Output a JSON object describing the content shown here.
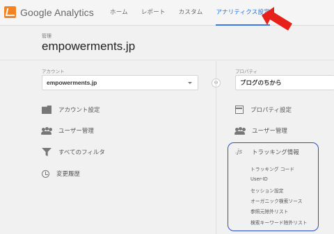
{
  "app": {
    "logo_text": "Google Analytics"
  },
  "nav": {
    "items": [
      {
        "label": "ホーム"
      },
      {
        "label": "レポート"
      },
      {
        "label": "カスタム"
      },
      {
        "label": "アナリティクス設定"
      }
    ],
    "active_index": 3
  },
  "header": {
    "breadcrumb": "管理",
    "site_name": "empowerments.jp"
  },
  "account": {
    "label": "アカウント",
    "selected": "empowerments.jp",
    "menu": [
      {
        "label": "アカウント設定",
        "icon": "building-icon"
      },
      {
        "label": "ユーザー管理",
        "icon": "people-icon"
      },
      {
        "label": "すべてのフィルタ",
        "icon": "filter-icon"
      },
      {
        "label": "変更履歴",
        "icon": "history-icon"
      }
    ]
  },
  "property": {
    "label": "プロパティ",
    "selected": "ブログのちから",
    "menu": [
      {
        "label": "プロパティ設定",
        "icon": "property-icon"
      },
      {
        "label": "ユーザー管理",
        "icon": "people-icon"
      },
      {
        "label": "トラッキング情報",
        "icon": "js-icon"
      }
    ],
    "tracking_sub": [
      "トラッキング コード",
      "User-ID",
      "セッション設定",
      "オーガニック検索ソース",
      "参照元除外リスト",
      "検索キーワード除外リスト"
    ]
  },
  "colors": {
    "accent": "#3b78e7",
    "highlight_box": "#2d4ec8",
    "arrow": "#e8201a",
    "logo": "#f58220"
  }
}
